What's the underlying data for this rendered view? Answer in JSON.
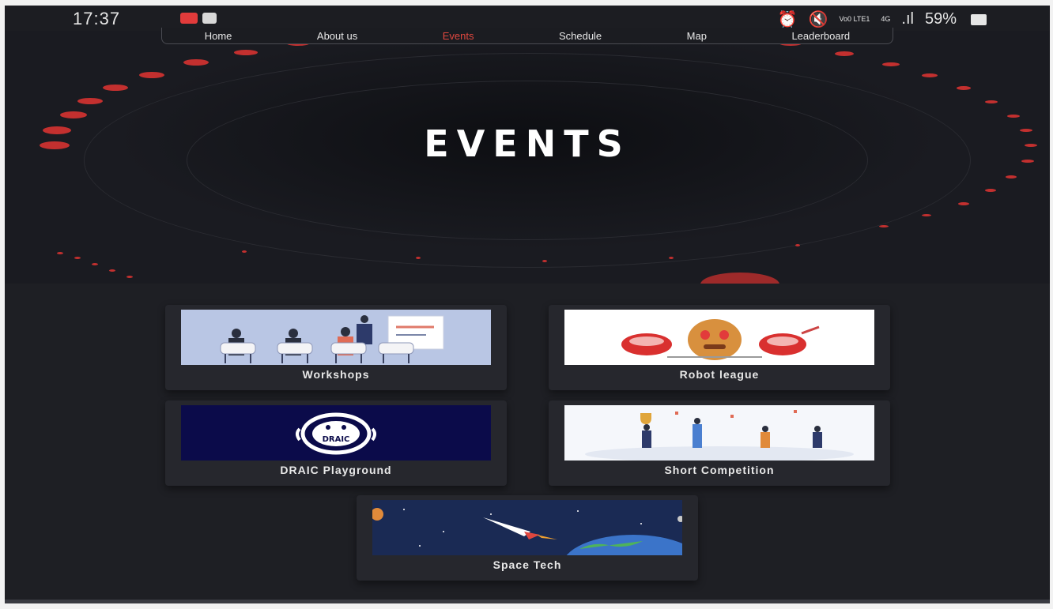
{
  "status_bar": {
    "time": "17:37",
    "lte_label": "Vo0 LTE1",
    "net_label": "4G",
    "signal": ".ıl",
    "battery": "59%"
  },
  "nav": {
    "items": [
      "Home",
      "About us",
      "Events",
      "Schedule",
      "Map",
      "Leaderboard"
    ],
    "active": "Events"
  },
  "hero": {
    "title": "EVENTS"
  },
  "events": [
    {
      "label": "Workshops",
      "icon": "workshop-illustration"
    },
    {
      "label": "Robot league",
      "icon": "robot-league-illustration"
    },
    {
      "label": "DRAIC Playground",
      "icon": "draic-logo",
      "logo_text": "DRAIC"
    },
    {
      "label": "Short Competition",
      "icon": "trophy-celebration-illustration"
    },
    {
      "label": "Space Tech",
      "icon": "rocket-earth-illustration"
    }
  ],
  "colors": {
    "accent": "#e0473f",
    "background": "#1e1f24",
    "card": "#26272d"
  }
}
